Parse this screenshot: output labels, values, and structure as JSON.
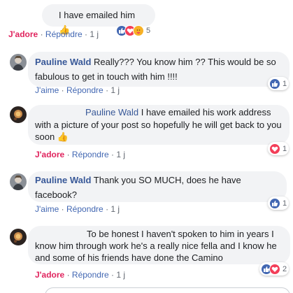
{
  "comments": [
    {
      "text": "I have emailed him",
      "emoji": "👍",
      "action_like": "J'adore",
      "action_reply": "Répondre",
      "time": "1 j",
      "reactions": {
        "count": "5"
      }
    },
    {
      "author": "Pauline Wald",
      "text": " Really??? You know him ?? This would be so fabulous to get in touch with him !!!!",
      "action_like": "J'aime",
      "action_reply": "Répondre",
      "time": "1 j",
      "reactions": {
        "count": "1"
      }
    },
    {
      "author": "Pauline Wald",
      "text": " I have emailed his work address with a picture of your post so hopefully he will get back to you soon",
      "emoji": "👍",
      "action_like": "J'adore",
      "action_reply": "Répondre",
      "time": "1 j",
      "reactions": {
        "count": "1"
      }
    },
    {
      "author": "Pauline Wald",
      "text": " Thank you SO MUCH, does he have facebook?",
      "action_like": "J'aime",
      "action_reply": "Répondre",
      "time": "1 j",
      "reactions": {
        "count": "1"
      }
    },
    {
      "text": "To be honest I haven't spoken to him in years I know him through work he's a really nice fella and I know he and some of his friends have done the Camino",
      "action_like": "J'adore",
      "action_reply": "Répondre",
      "time": "1 j",
      "reactions": {
        "count": "2"
      }
    }
  ],
  "colors": {
    "like_blue": "#4267b2",
    "love_red": "#f33e58",
    "bubble_bg": "#f2f3f5",
    "author_blue": "#385898",
    "jadore_red": "#e0245e"
  }
}
